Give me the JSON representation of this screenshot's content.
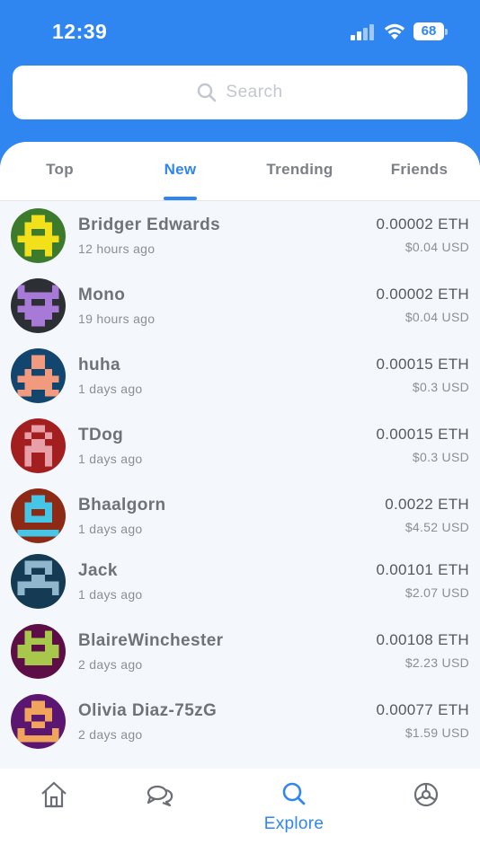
{
  "status_bar": {
    "time": "12:39",
    "battery": "68"
  },
  "search": {
    "placeholder": "Search",
    "icon": "search-icon"
  },
  "tabs": [
    {
      "label": "Top",
      "active": false
    },
    {
      "label": "New",
      "active": true
    },
    {
      "label": "Trending",
      "active": false
    },
    {
      "label": "Friends",
      "active": false
    }
  ],
  "users": [
    {
      "name": "Bridger Edwards",
      "time": "12 hours ago",
      "eth": "0.00002 ETH",
      "usd": "$0.04 USD",
      "avatar_bg": "#3c7a2c",
      "avatar_fg": "#f2e01a"
    },
    {
      "name": "Mono",
      "time": "19 hours ago",
      "eth": "0.00002 ETH",
      "usd": "$0.04 USD",
      "avatar_bg": "#2c2f33",
      "avatar_fg": "#a67ad6"
    },
    {
      "name": "huha",
      "time": "1 days ago",
      "eth": "0.00015 ETH",
      "usd": "$0.3 USD",
      "avatar_bg": "#12466e",
      "avatar_fg": "#f29a7e"
    },
    {
      "name": "TDog",
      "time": "1 days ago",
      "eth": "0.00015 ETH",
      "usd": "$0.3 USD",
      "avatar_bg": "#a31f1f",
      "avatar_fg": "#e8a0a8"
    },
    {
      "name": "Bhaalgorn",
      "time": "1 days ago",
      "eth": "0.0022 ETH",
      "usd": "$4.52 USD",
      "avatar_bg": "#8c2a16",
      "avatar_fg": "#45c6e6"
    },
    {
      "name": "Jack",
      "time": "1 days ago",
      "eth": "0.00101 ETH",
      "usd": "$2.07 USD",
      "avatar_bg": "#153a54",
      "avatar_fg": "#8fb6cc"
    },
    {
      "name": "BlaireWinchester",
      "time": "2 days ago",
      "eth": "0.00108 ETH",
      "usd": "$2.23 USD",
      "avatar_bg": "#5e0e46",
      "avatar_fg": "#a8c84c"
    },
    {
      "name": "Olivia Diaz-75zG",
      "time": "2 days ago",
      "eth": "0.00077 ETH",
      "usd": "$1.59 USD",
      "avatar_bg": "#5a1670",
      "avatar_fg": "#f0a45c"
    }
  ],
  "bottom_nav": [
    {
      "icon": "home-icon",
      "label": "",
      "active": false
    },
    {
      "icon": "chat-icon",
      "label": "",
      "active": false
    },
    {
      "icon": "search-icon",
      "label": "Explore",
      "active": true
    },
    {
      "icon": "settings-icon",
      "label": "",
      "active": false
    }
  ],
  "colors": {
    "accent": "#2f86f0",
    "text_primary": "#6f7379",
    "text_secondary": "#8a8f96",
    "background": "#f4f7fb"
  }
}
